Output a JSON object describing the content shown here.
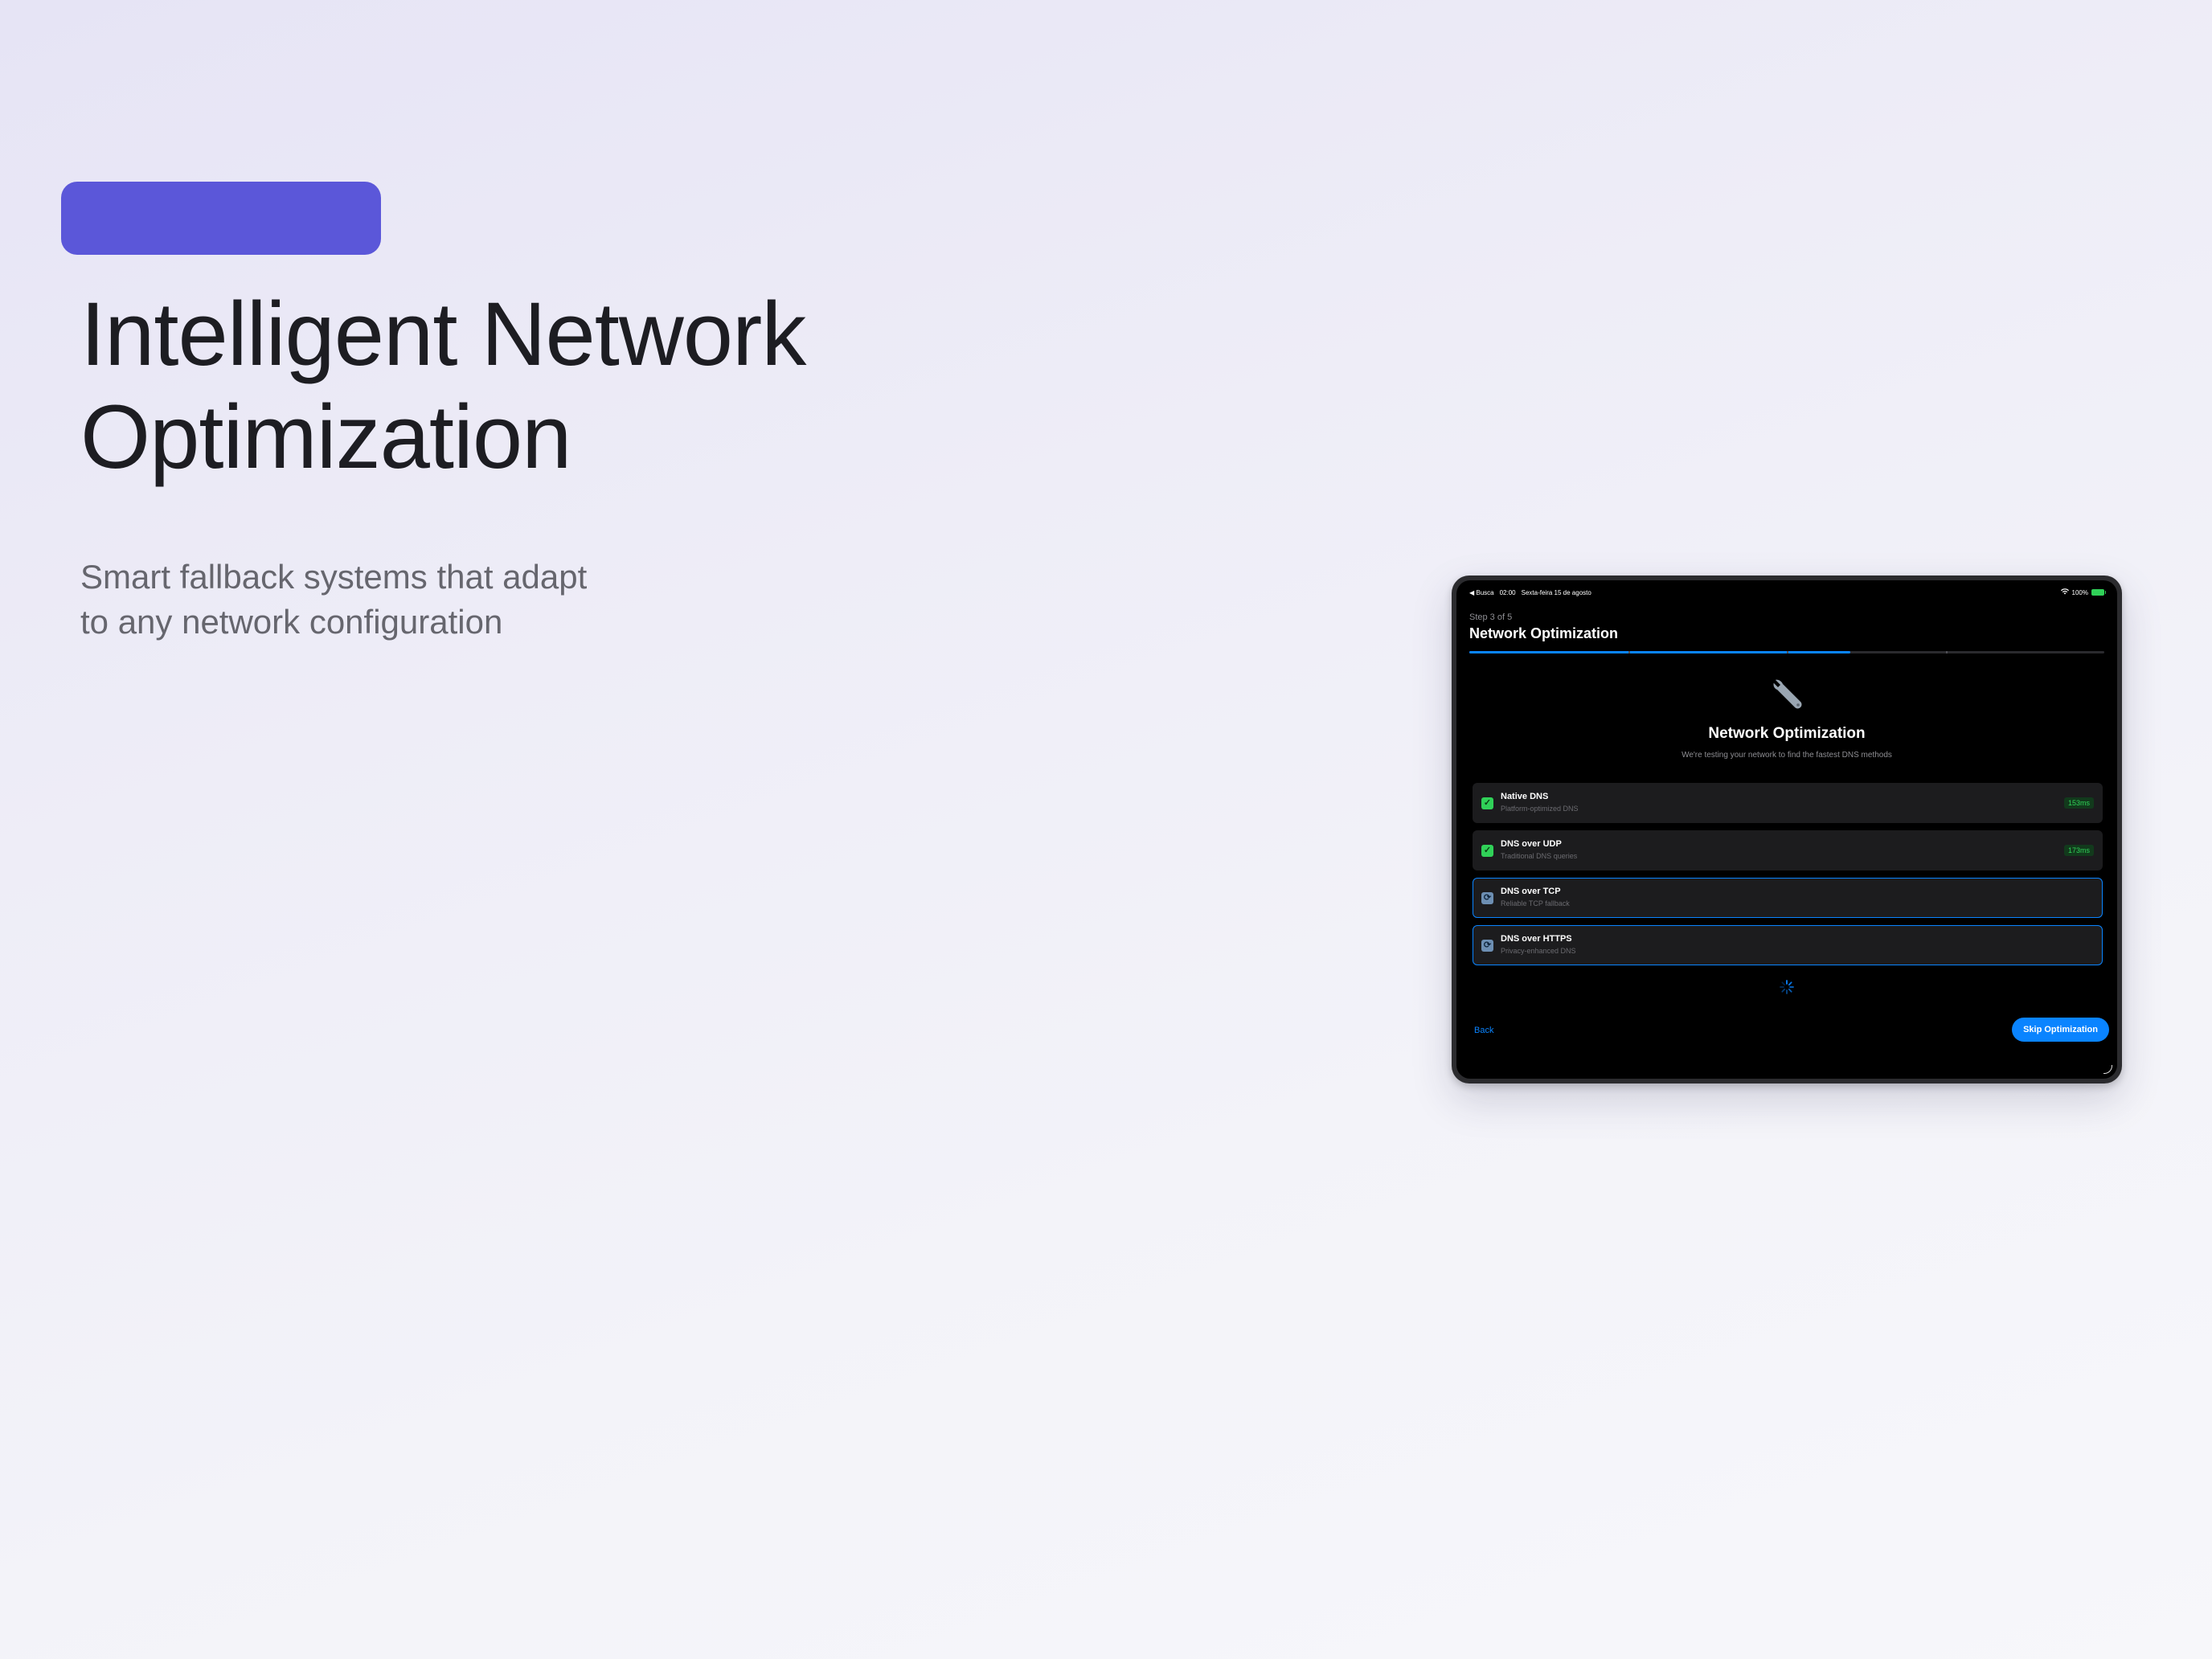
{
  "hero": {
    "headline_line1": "Intelligent Network",
    "headline_line2": "Optimization",
    "subtitle_line1": "Smart fallback systems that adapt",
    "subtitle_line2": "to any network configuration",
    "accent_color": "#5b57d9"
  },
  "device": {
    "status_bar": {
      "back_app": "◀ Busca",
      "time": "02:00",
      "date": "Sexta-feira 15 de agosto",
      "battery": "100%"
    },
    "step_label": "Step 3 of 5",
    "screen_title": "Network Optimization",
    "progress": 0.6,
    "icon": "wrench-icon",
    "optimization_title": "Network Optimization",
    "optimization_subtitle": "We're testing your network to find the fastest DNS methods",
    "methods": [
      {
        "name": "Native DNS",
        "description": "Platform-optimized DNS",
        "status": "done",
        "latency": "153ms"
      },
      {
        "name": "DNS over UDP",
        "description": "Traditional DNS queries",
        "status": "done",
        "latency": "173ms"
      },
      {
        "name": "DNS over TCP",
        "description": "Reliable TCP fallback",
        "status": "testing"
      },
      {
        "name": "DNS over HTTPS",
        "description": "Privacy-enhanced DNS",
        "status": "testing"
      }
    ],
    "back_label": "Back",
    "skip_label": "Skip Optimization",
    "accent_color": "#0a84ff",
    "success_color": "#30d158"
  }
}
